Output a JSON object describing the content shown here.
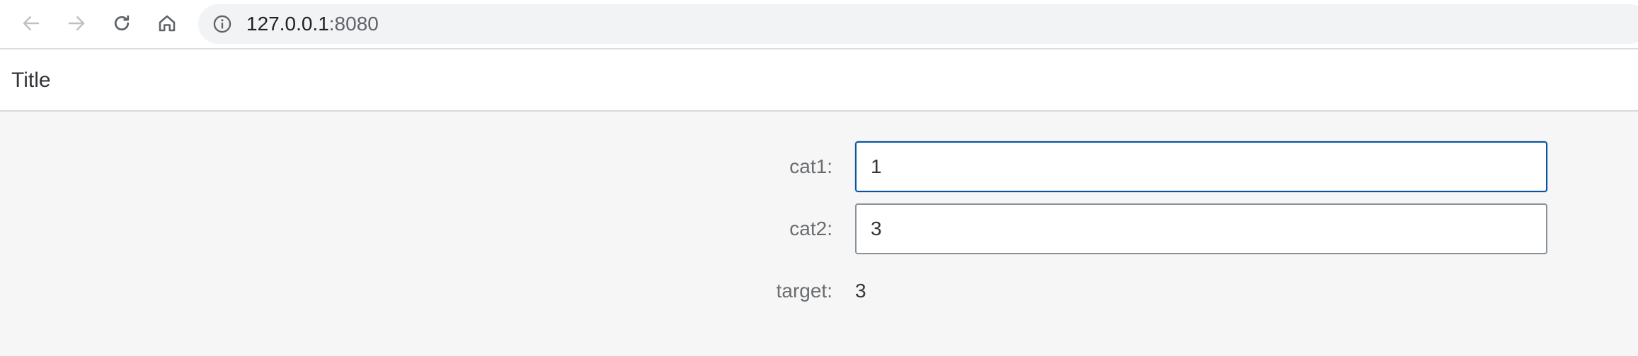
{
  "browser": {
    "url_host": "127.0.0.1",
    "url_port": ":8080",
    "icons": [
      "back-arrow-icon",
      "forward-arrow-icon",
      "reload-icon",
      "home-icon",
      "info-icon"
    ]
  },
  "header": {
    "title": "Title"
  },
  "form": {
    "cat1": {
      "label": "cat1:",
      "value": "1"
    },
    "cat2": {
      "label": "cat2:",
      "value": "3"
    },
    "target": {
      "label": "target:",
      "value": "3"
    }
  },
  "colors": {
    "focus_border": "#0854a0",
    "input_border": "#89919a",
    "content_bg": "#f6f6f6",
    "label_text": "#6a6d70"
  }
}
